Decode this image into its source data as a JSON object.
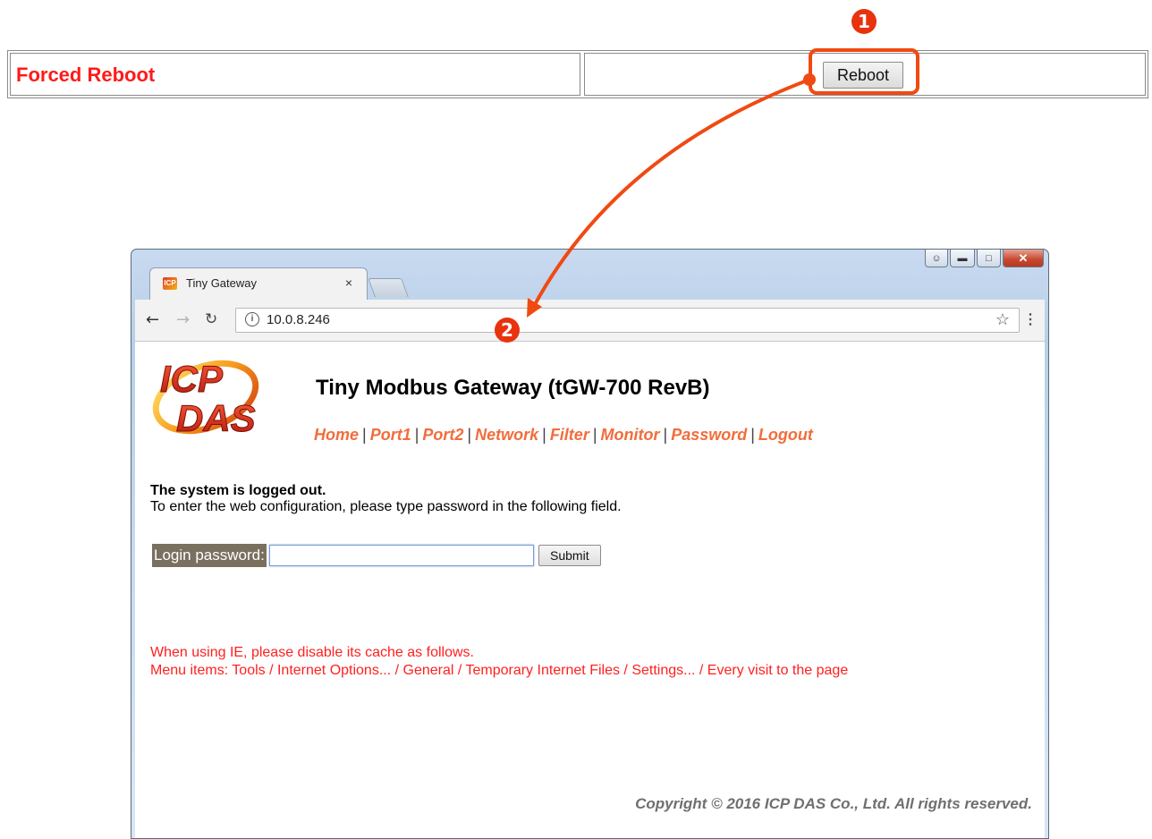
{
  "top_table": {
    "title": "Forced Reboot",
    "reboot_label": "Reboot"
  },
  "steps": {
    "step1": "1",
    "step2": "2"
  },
  "colors": {
    "accent_annotation": "#f04a12",
    "title_red": "#ff1a1a",
    "nav_orange": "#f26d3c",
    "note_red": "#ff2020",
    "label_bg": "#7a705f"
  },
  "browser": {
    "tab_title": "Tiny Gateway",
    "tab_close": "×",
    "url": "10.0.8.246",
    "icons": [
      "back-arrow-icon",
      "forward-arrow-icon",
      "reload-icon",
      "info-icon",
      "star-icon",
      "menu-icon"
    ]
  },
  "page": {
    "logo_text": [
      "ICP",
      "DAS"
    ],
    "title": "Tiny Modbus Gateway (tGW-700 RevB)",
    "nav": [
      "Home",
      "Port1",
      "Port2",
      "Network",
      "Filter",
      "Monitor",
      "Password",
      "Logout"
    ],
    "logout_heading": "The system is logged out.",
    "logout_desc": "To enter the web configuration, please type password in the following field.",
    "login_label": "Login password:",
    "login_value": "",
    "submit_label": "Submit",
    "ie_note_line1": "When using IE, please disable its cache as follows.",
    "ie_note_line2": "Menu items: Tools / Internet Options... / General / Temporary Internet Files / Settings... / Every visit to the page",
    "copyright": "Copyright © 2016 ICP DAS Co., Ltd. All rights reserved."
  }
}
